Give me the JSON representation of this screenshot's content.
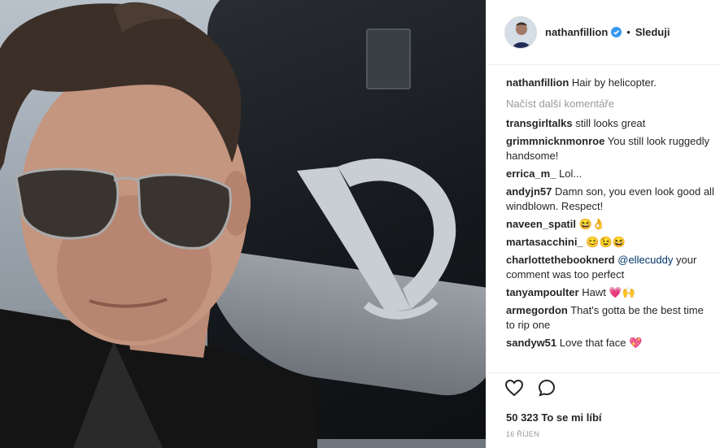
{
  "header": {
    "username": "nathanfillion",
    "follow_label": "Sleduji",
    "separator": "•"
  },
  "caption": {
    "user": "nathanfillion",
    "text": "Hair by helicopter."
  },
  "load_more_label": "Načíst další komentáře",
  "comments": [
    {
      "user": "transgirltalks",
      "text": "still looks great"
    },
    {
      "user": "grimmnicknmonroe",
      "text": "You still look ruggedly handsome!"
    },
    {
      "user": "errica_m_",
      "text": "Lol..."
    },
    {
      "user": "andyjn57",
      "text": "Damn son, you even look good all windblown. Respect!"
    },
    {
      "user": "naveen_spatil",
      "text": "😆👌"
    },
    {
      "user": "martasacchini_",
      "text": "😊😉😆"
    },
    {
      "user": "charlottethebooknerd",
      "mention": "@ellecuddy",
      "text": "your comment was too perfect"
    },
    {
      "user": "tanyampoulter",
      "text": "Hawt 💗🙌"
    },
    {
      "user": "armegordon",
      "text": "That's gotta be the best time to rip one"
    },
    {
      "user": "sandyw51",
      "text": "Love that face 💖"
    }
  ],
  "likes": "50 323 To se mi líbí",
  "date": "16 ŘÍJEN",
  "icons": {
    "like": "heart-icon",
    "comment": "comment-icon",
    "verified": "verified-badge-icon"
  },
  "colors": {
    "verified_blue": "#3897f0",
    "mention": "#003569",
    "muted": "#999999"
  }
}
